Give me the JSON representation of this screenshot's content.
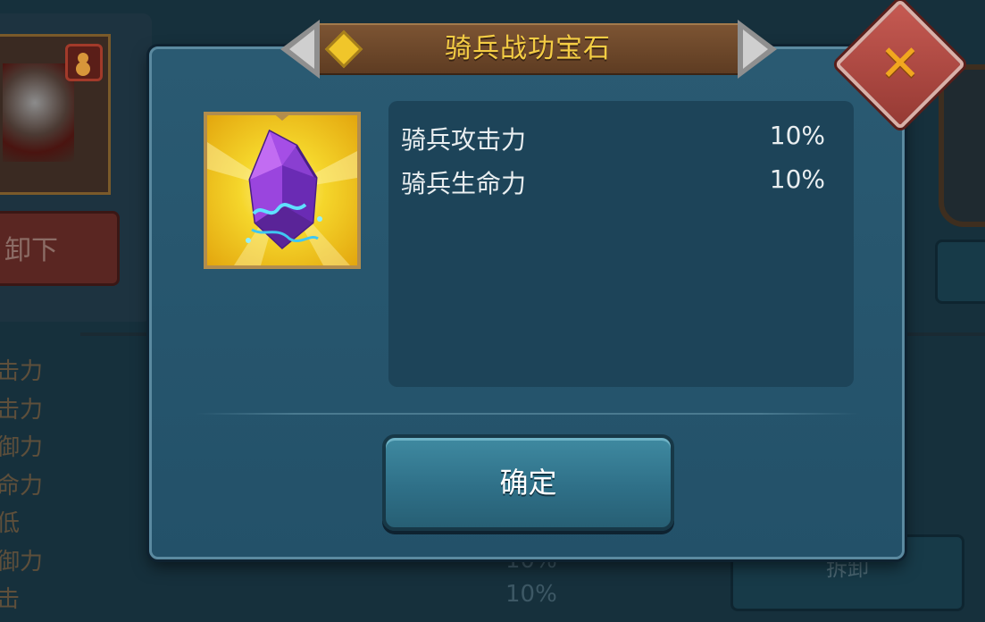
{
  "dialog": {
    "title": "骑兵战功宝石",
    "close_icon": "close-x-icon",
    "gem_icon": "purple-crystal-gem-icon",
    "stats": [
      {
        "label": "骑兵攻击力",
        "value": "10%"
      },
      {
        "label": "骑兵生命力",
        "value": "10%"
      }
    ],
    "confirm_label": "确定"
  },
  "background": {
    "unequip_label": "卸下",
    "stat_labels": [
      "击力",
      "击力",
      "御力",
      "命力",
      "低",
      "御力",
      "击"
    ],
    "ghost_values": [
      "10%",
      "10%"
    ],
    "ghost_button_label": "拆卸"
  },
  "colors": {
    "title_text": "#f4cd44",
    "close_button": "#c65a52",
    "confirm_button": "#2f7088",
    "dialog_bg": "#2a5a72"
  }
}
